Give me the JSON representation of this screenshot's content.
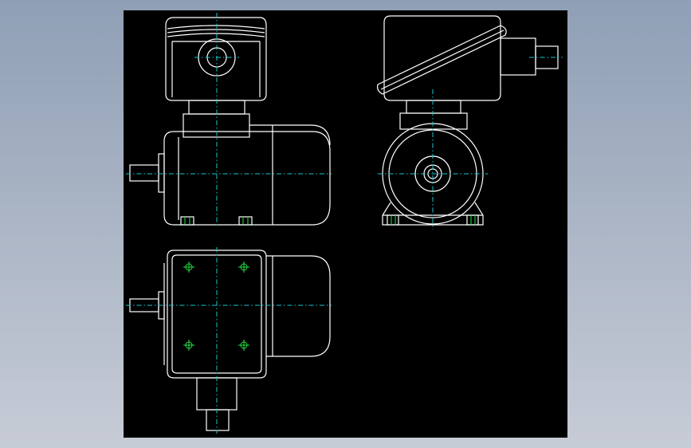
{
  "colors": {
    "background_top": "#8f9fb5",
    "background_bottom": "#c7ccd6",
    "drawing_area": "#000000",
    "outline": "#ffffff",
    "center_line": "#18c8d0",
    "hole_marks": "#22e040"
  },
  "views": [
    "front-view",
    "side-view",
    "top-view"
  ]
}
